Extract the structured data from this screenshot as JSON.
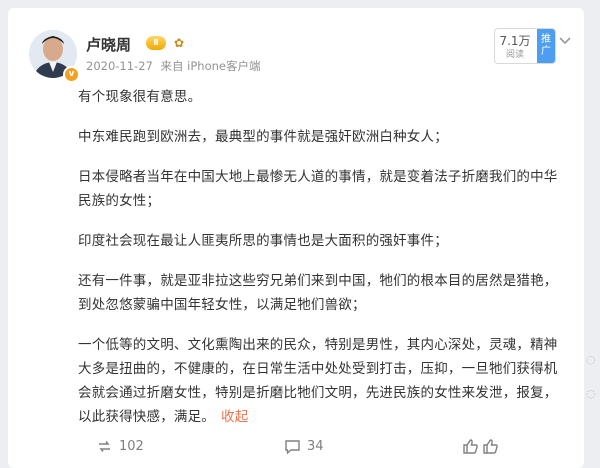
{
  "post": {
    "username": "卢晓周",
    "level_badge": "Ⅱ",
    "verified_mark": "v",
    "date": "2020-11-27",
    "source": "来自 iPhone客户端",
    "read_count": "7.1万",
    "read_label": "阅读",
    "promote_label_top": "推",
    "promote_label_bottom": "广",
    "paragraphs": [
      "有个现象很有意思。",
      "中东难民跑到欧洲去，最典型的事件就是强奸欧洲白种女人；",
      "日本侵略者当年在中国大地上最惨无人道的事情，就是变着法子折磨我们的中华民族的女性；",
      "印度社会现在最让人匪夷所思的事情也是大面积的强奸事件；",
      "还有一件事，就是亚非拉这些穷兄弟们来到中国，牠们的根本目的居然是猎艳，到处忽悠蒙骗中国年轻女性，以满足牠们兽欲；",
      "一个低等的文明、文化熏陶出来的民众，特别是男性，其内心深处，灵魂，精神大多是扭曲的，不健康的，在日常生活中处处受到打击，压抑，一旦牠们获得机会就会通过折磨女性，特别是折磨比牠们文明，先进民族的女性来发泄，报复，以此获得快感，满足。"
    ],
    "collapse_label": "收起",
    "repost_count": "102",
    "comment_count": "34",
    "like_count": ""
  },
  "colors": {
    "link_orange": "#eb7350",
    "promote_blue": "#4d9ef0",
    "badge_gold": "#f2a900",
    "page_bg": "#eceef1"
  },
  "icons": [
    "repost-icon",
    "comment-icon",
    "like-icon",
    "more-icon",
    "verified-icon",
    "medal-icon"
  ]
}
